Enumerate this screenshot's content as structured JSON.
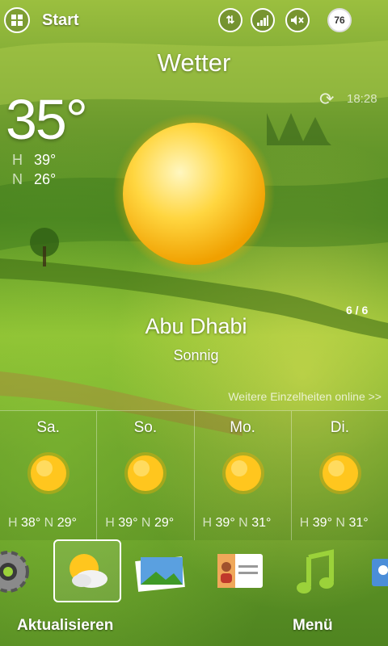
{
  "status_bar": {
    "start_label": "Start",
    "battery_level": "76",
    "icons": [
      "windows-start-icon",
      "data-connection-icon",
      "signal-strength-icon",
      "volume-muted-icon",
      "battery-icon"
    ]
  },
  "weather": {
    "title": "Wetter",
    "update_time": "18:28",
    "current_temp": "35°",
    "high_label": "H",
    "high_value": "39°",
    "low_label": "N",
    "low_value": "26°",
    "city": "Abu Dhabi",
    "condition": "Sonnig",
    "page_indicator": "6 / 6",
    "more_details_link": "Weitere Einzelheiten online >>"
  },
  "forecast": [
    {
      "day": "Sa.",
      "high_label": "H",
      "high": "38°",
      "low_label": "N",
      "low": "29°"
    },
    {
      "day": "So.",
      "high_label": "H",
      "high": "39°",
      "low_label": "N",
      "low": "29°"
    },
    {
      "day": "Mo.",
      "high_label": "H",
      "high": "39°",
      "low_label": "N",
      "low": "31°"
    },
    {
      "day": "Di.",
      "high_label": "H",
      "high": "39°",
      "low_label": "N",
      "low": "31°"
    }
  ],
  "tabs": [
    "settings-gear-icon",
    "weather-tab-icon",
    "photos-tab-icon",
    "contacts-tab-icon",
    "music-tab-icon",
    "people-tab-icon"
  ],
  "softkeys": {
    "left": "Aktualisieren",
    "right": "Menü"
  },
  "colors": {
    "sun_core": "#ffcc22",
    "sun_glow": "#ffae00",
    "grass": "#6aa22a"
  }
}
